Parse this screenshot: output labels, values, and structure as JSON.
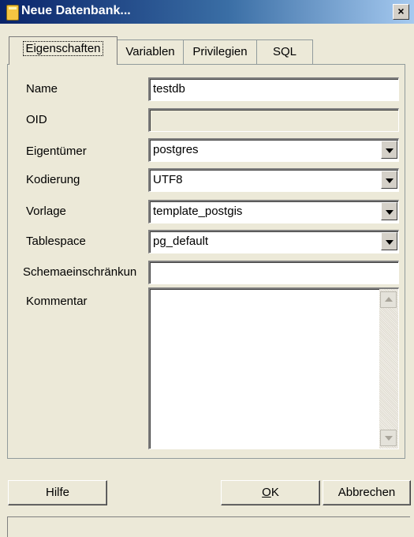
{
  "window": {
    "title": "Neue Datenbank...",
    "close_label": "×"
  },
  "tabs": [
    {
      "label": "Eigenschaften",
      "active": true
    },
    {
      "label": "Variablen",
      "active": false
    },
    {
      "label": "Privilegien",
      "active": false
    },
    {
      "label": "SQL",
      "active": false
    }
  ],
  "form": {
    "name": {
      "label": "Name",
      "value": "testdb"
    },
    "oid": {
      "label": "OID",
      "value": ""
    },
    "owner": {
      "label": "Eigentümer",
      "value": "postgres"
    },
    "encoding": {
      "label": "Kodierung",
      "value": "UTF8"
    },
    "template": {
      "label": "Vorlage",
      "value": "template_postgis"
    },
    "tablespace": {
      "label": "Tablespace",
      "value": "pg_default"
    },
    "schema_restriction": {
      "label": "Schemaeinschränkun",
      "value": ""
    },
    "comment": {
      "label": "Kommentar",
      "value": ""
    }
  },
  "buttons": {
    "help": "Hilfe",
    "ok_accel": "O",
    "ok_rest": "K",
    "cancel": "Abbrechen"
  }
}
